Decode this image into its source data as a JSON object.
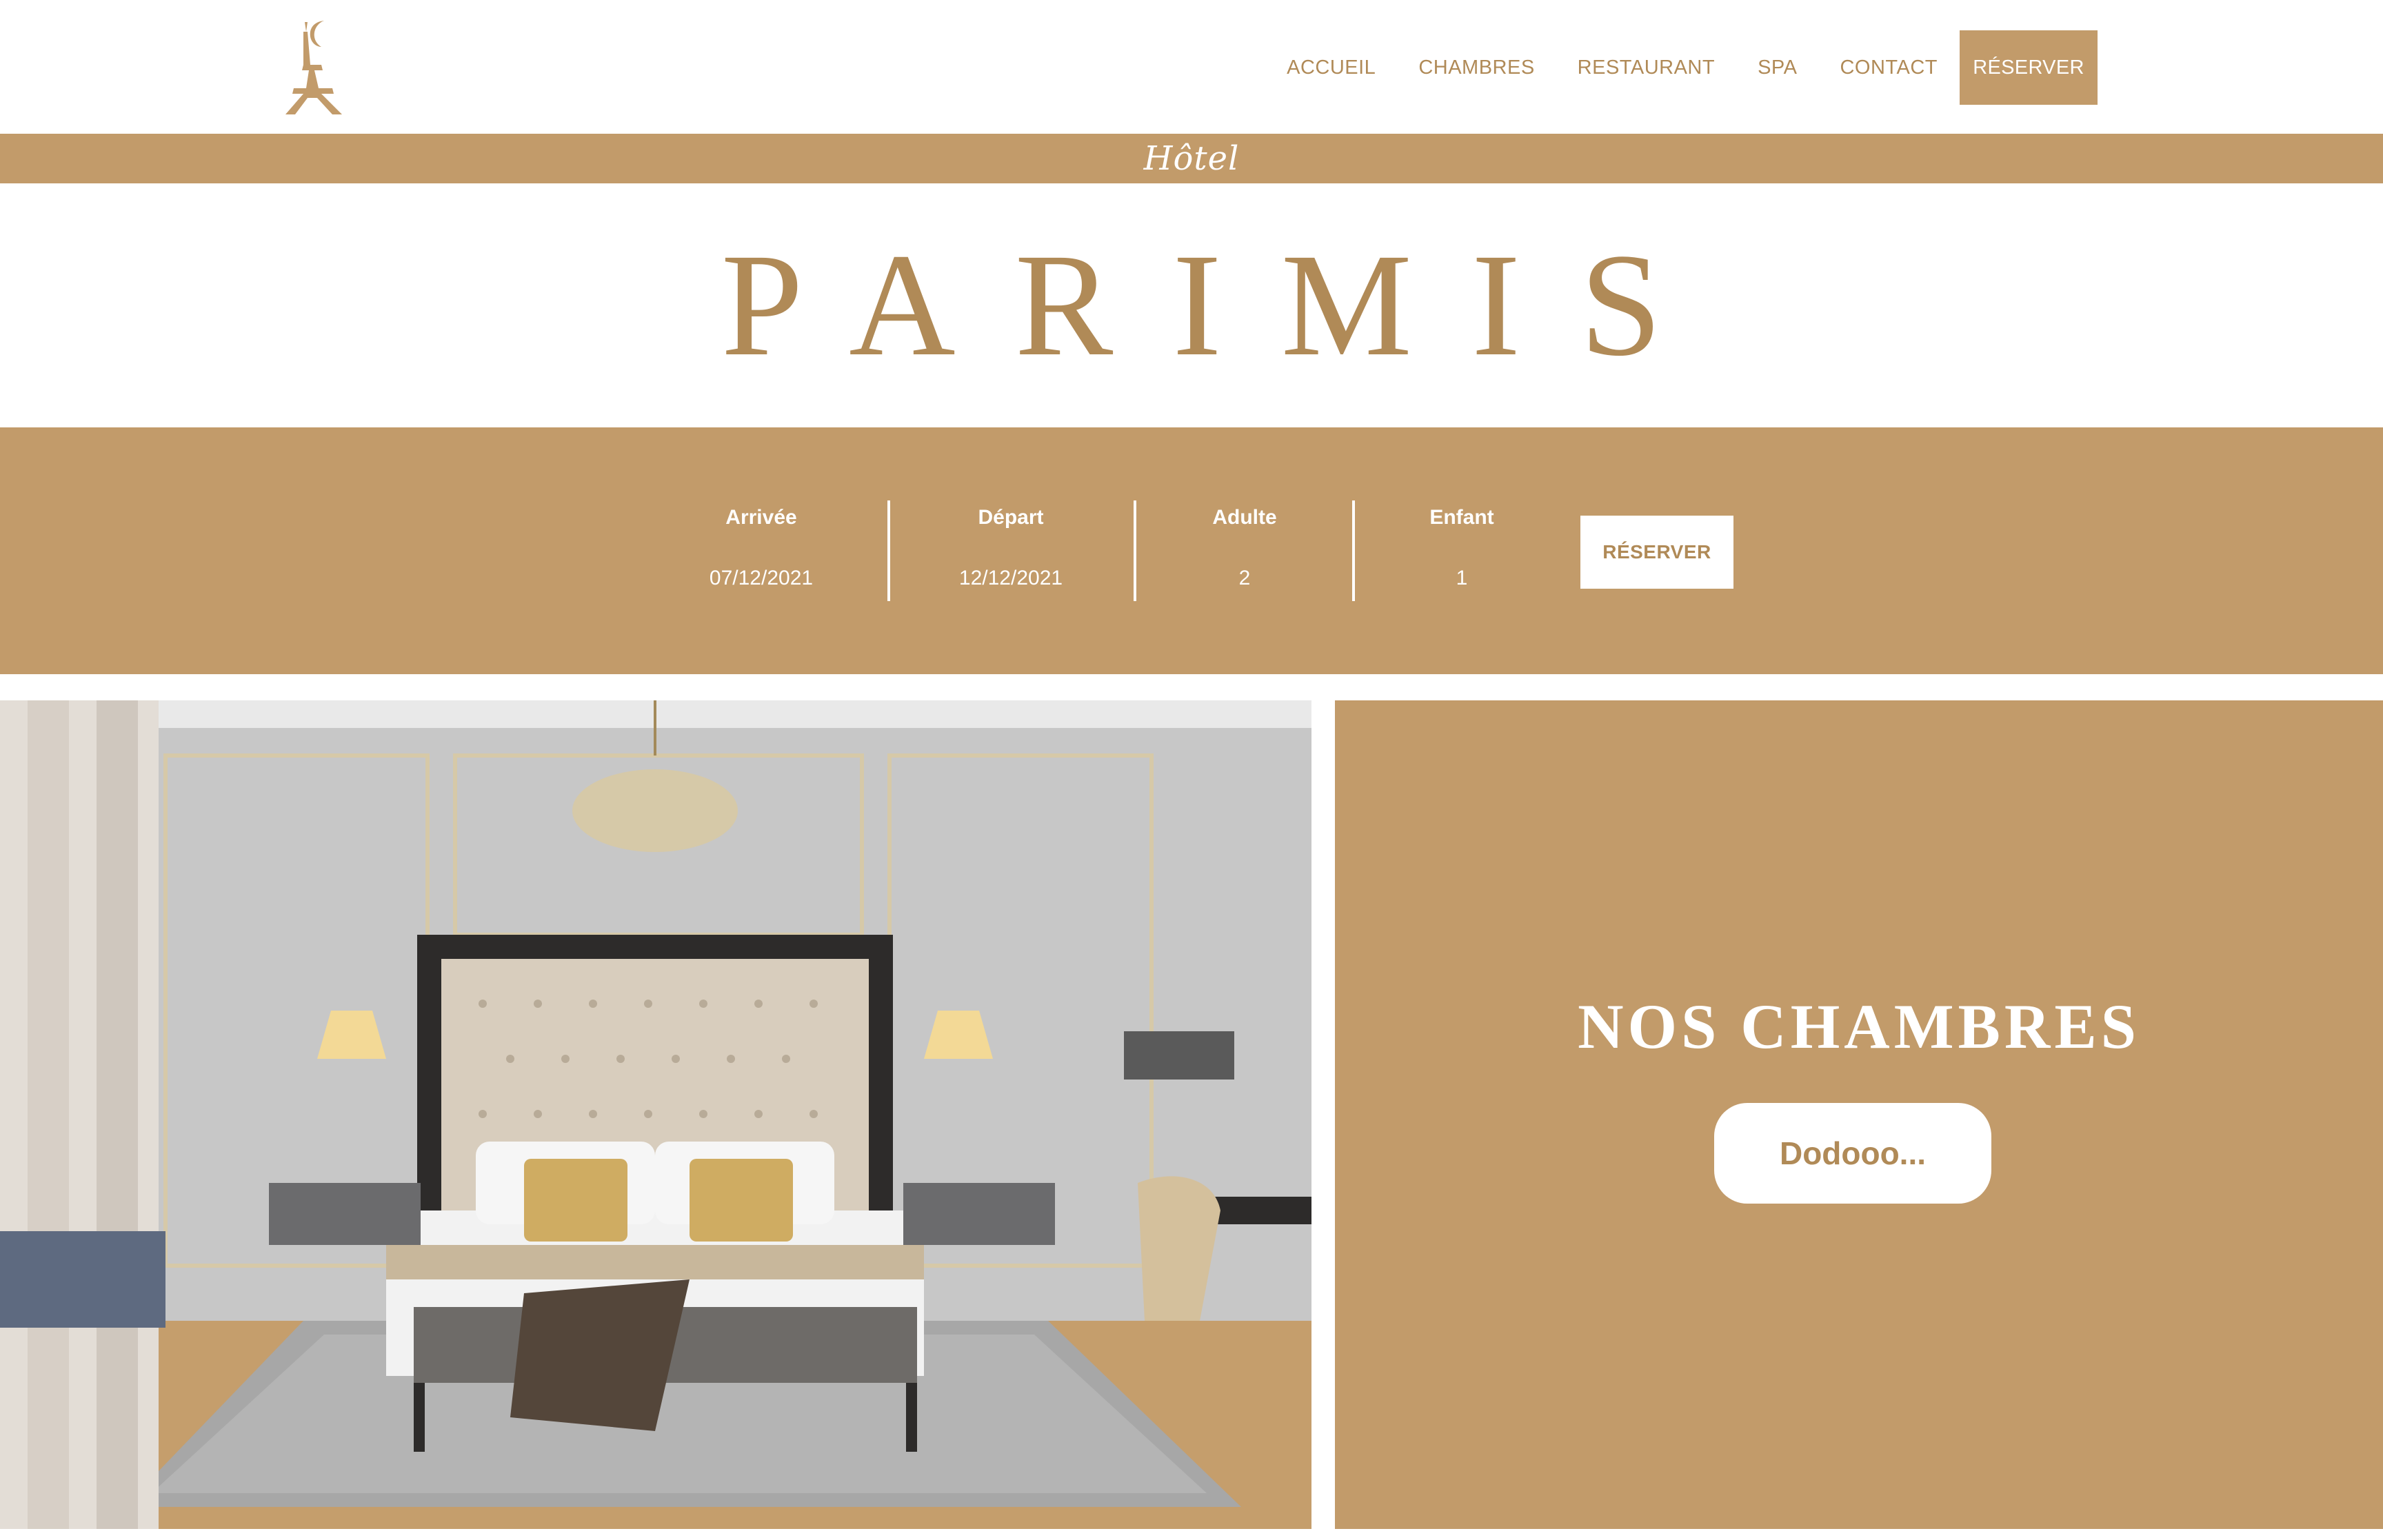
{
  "header": {
    "logo_icon": "eiffel-tower-moon-icon",
    "nav": [
      {
        "label": "ACCUEIL"
      },
      {
        "label": "CHAMBRES"
      },
      {
        "label": "RESTAURANT"
      },
      {
        "label": "SPA"
      },
      {
        "label": "CONTACT"
      }
    ],
    "cta_label": "RÉSERVER"
  },
  "hotel_band": {
    "script_text": "Hôtel"
  },
  "title": "PARIMIS",
  "booking": {
    "fields": [
      {
        "label": "Arrivée",
        "value": "07/12/2021"
      },
      {
        "label": "Départ",
        "value": "12/12/2021"
      },
      {
        "label": "Adulte",
        "value": "2"
      },
      {
        "label": "Enfant",
        "value": "1"
      }
    ],
    "button_label": "RÉSERVER"
  },
  "rooms_section": {
    "title": "NOS CHAMBRES",
    "button_label": "Dodooo..."
  },
  "colors": {
    "gold": "#c29b6a",
    "gold_text": "#b08a57",
    "white": "#ffffff"
  }
}
